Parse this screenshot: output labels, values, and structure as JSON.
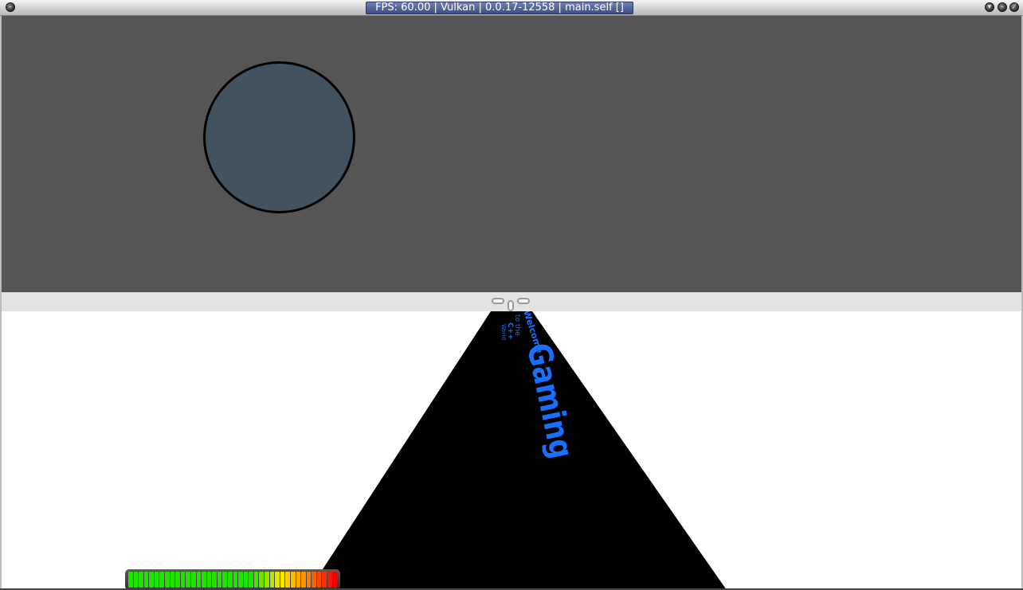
{
  "window": {
    "title": "FPS: 60.00 | Vulkan | 0.0.17-12558 | main.self []",
    "menu_icon": "window-menu-icon",
    "shade_icon": "shade-icon",
    "minimize_icon": "minimize-icon",
    "close_icon": "close-icon"
  },
  "scene": {
    "top_background": "#555555",
    "circle_color": "#43525f",
    "road_color": "#000000",
    "road_text_color": "#1a6fff",
    "road_text_lines": [
      "Welcome",
      "to the",
      "Gaming",
      "C++",
      "World"
    ]
  },
  "meter": {
    "level": 1.0,
    "segment_count": 40
  }
}
